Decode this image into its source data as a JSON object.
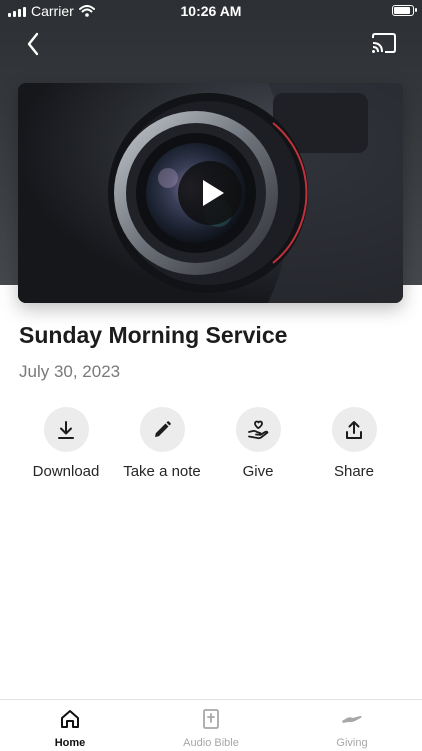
{
  "status_bar": {
    "carrier": "Carrier",
    "time": "10:26 AM"
  },
  "header": {
    "back_icon": "chevron-left-icon",
    "cast_icon": "cast-icon"
  },
  "media": {
    "play_icon": "play-icon"
  },
  "sermon": {
    "title": "Sunday Morning Service",
    "date": "July 30, 2023"
  },
  "actions": [
    {
      "label": "Download",
      "icon": "download-icon"
    },
    {
      "label": "Take a note",
      "icon": "pencil-icon"
    },
    {
      "label": "Give",
      "icon": "heart-hand-icon"
    },
    {
      "label": "Share",
      "icon": "share-icon"
    }
  ],
  "tabs": [
    {
      "label": "Home",
      "icon": "home-icon",
      "active": true
    },
    {
      "label": "Audio Bible",
      "icon": "bible-icon",
      "active": false
    },
    {
      "label": "Giving",
      "icon": "giving-hand-icon",
      "active": false
    }
  ],
  "colors": {
    "header_bg": "#2c2f33",
    "action_circle": "#ececec",
    "tab_active": "#111111",
    "tab_inactive": "#a7a7a7"
  }
}
